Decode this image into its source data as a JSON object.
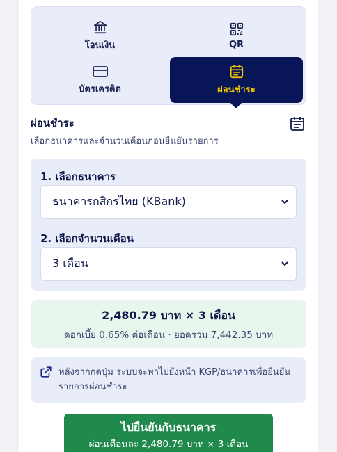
{
  "methods": [
    {
      "label": "โอนเงิน",
      "icon": "bank-icon",
      "selected": false
    },
    {
      "label": "QR",
      "icon": "qr-code-icon",
      "selected": false
    },
    {
      "label": "บัตรเครดิต",
      "icon": "credit-card-icon",
      "selected": false
    },
    {
      "label": "ผ่อนชำระ",
      "icon": "calendar-icon",
      "selected": true
    }
  ],
  "section": {
    "title": "ผ่อนชำระ",
    "subtitle": "เลือกธนาคารและจำนวนเดือนก่อนยืนยันรายการ",
    "icon": "calendar-icon"
  },
  "bank_field": {
    "label": "1. เลือกธนาคาร",
    "value": "ธนาคารกสิกรไทย (KBank)"
  },
  "month_field": {
    "label": "2. เลือกจำนวนเดือน",
    "value": "3 เดือน"
  },
  "summary": {
    "main": "2,480.79 บาท × 3 เดือน",
    "sub": "ดอกเบี้ย 0.65% ต่อเดือน · ยอดรวม 7,442.35 บาท"
  },
  "note": {
    "icon": "external-link-icon",
    "text": "หลังจากกดปุ่ม ระบบจะพาไปยังหน้า KGP/ธนาคารเพื่อยืนยันรายการผ่อนชำระ"
  },
  "cta": {
    "main": "ไปยืนยันกับธนาคาร",
    "sub": "ผ่อนเดือนละ 2,480.79 บาท × 3 เดือน"
  },
  "colors": {
    "accent_navy": "#081658",
    "accent_yellow": "#f5c400",
    "cta_green": "#1f8a4c",
    "summary_bg": "#e8f6ee",
    "panel_bg": "#e9edf9"
  }
}
